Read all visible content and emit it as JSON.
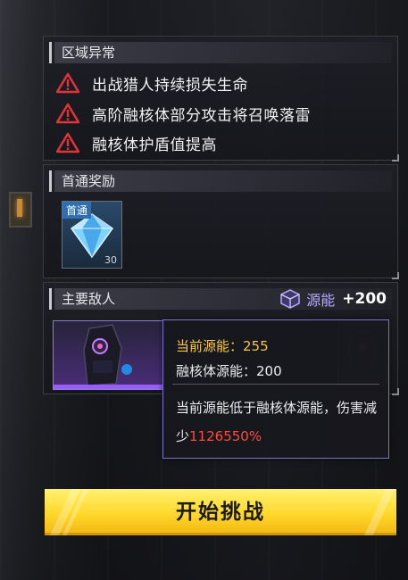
{
  "zone_anomaly": {
    "title": "区域异常",
    "items": [
      {
        "text": "出战猎人持续损失生命",
        "icon": "warning-icon"
      },
      {
        "text": "高阶融核体部分攻击将召唤落雷",
        "icon": "warning-icon"
      },
      {
        "text": "融核体护盾值提高",
        "icon": "warning-icon"
      }
    ]
  },
  "first_clear_reward": {
    "title": "首通奖励",
    "item": {
      "tag": "首通",
      "count": "30",
      "icon": "diamond-icon"
    }
  },
  "main_enemy": {
    "title": "主要敌人",
    "energy": {
      "label": "源能",
      "value": "+200",
      "icon": "energy-cube-icon"
    }
  },
  "tooltip": {
    "current_label": "当前源能：",
    "current_value": "255",
    "core_label": "融核体源能：",
    "core_value": "200",
    "desc": "当前源能低于融核体源能，伤害减少",
    "reduction": "1126550%"
  },
  "start_button": {
    "label": "开始挑战"
  },
  "colors": {
    "warning": "#e0333a",
    "accent_yellow": "#ffd72a",
    "current_value": "#f5c842",
    "reduction": "#ff4a3d",
    "energy_purple": "#b9a9ff"
  }
}
